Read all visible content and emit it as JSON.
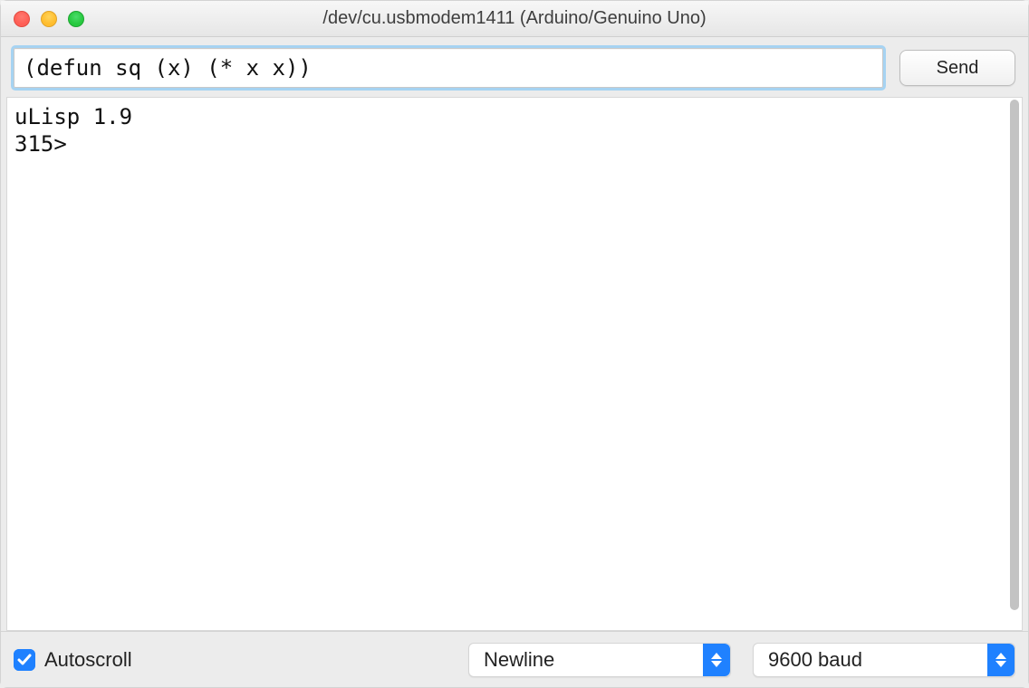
{
  "window": {
    "title": "/dev/cu.usbmodem1411 (Arduino/Genuino Uno)"
  },
  "input": {
    "value": "(defun sq (x) (* x x))"
  },
  "buttons": {
    "send": "Send"
  },
  "output": {
    "text": "uLisp 1.9\n315> "
  },
  "footer": {
    "autoscroll_label": "Autoscroll",
    "autoscroll_checked": true,
    "line_ending": "Newline",
    "baud": "9600 baud"
  }
}
